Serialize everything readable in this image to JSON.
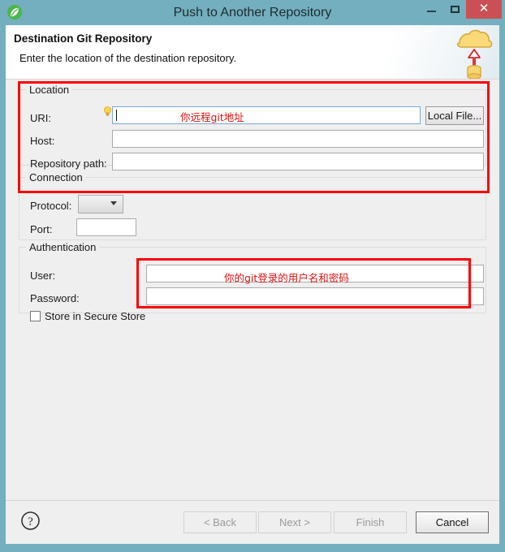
{
  "window": {
    "title": "Push to Another Repository",
    "app_icon": "leaf-icon",
    "controls": {
      "minimize": "–",
      "maximize": "□",
      "close": "✕"
    },
    "accent_titlebar": "#73AFBE",
    "close_color": "#CB5055"
  },
  "header": {
    "title": "Destination Git Repository",
    "subtitle": "Enter the location of the destination repository.",
    "icon": "cloud-upload-database-icon"
  },
  "location": {
    "group_label": "Location",
    "uri_label": "URI:",
    "uri_value": "",
    "uri_placeholder": "",
    "uri_hint_icon": "lightbulb-icon",
    "local_file_button": "Local File...",
    "host_label": "Host:",
    "host_value": "",
    "repo_path_label": "Repository path:",
    "repo_path_value": ""
  },
  "connection": {
    "group_label": "Connection",
    "protocol_label": "Protocol:",
    "protocol_value": "",
    "port_label": "Port:",
    "port_value": ""
  },
  "authentication": {
    "group_label": "Authentication",
    "user_label": "User:",
    "user_value": "",
    "password_label": "Password:",
    "password_value": "",
    "store_checkbox_label": "Store in Secure Store",
    "store_checked": false
  },
  "annotations": {
    "color": "#FF0000",
    "location_note": "你远程git地址",
    "auth_note": "你的git登录的用户名和密码"
  },
  "footer": {
    "help_icon": "question-mark-icon",
    "back_button": "< Back",
    "next_button": "Next >",
    "finish_button": "Finish",
    "cancel_button": "Cancel"
  }
}
